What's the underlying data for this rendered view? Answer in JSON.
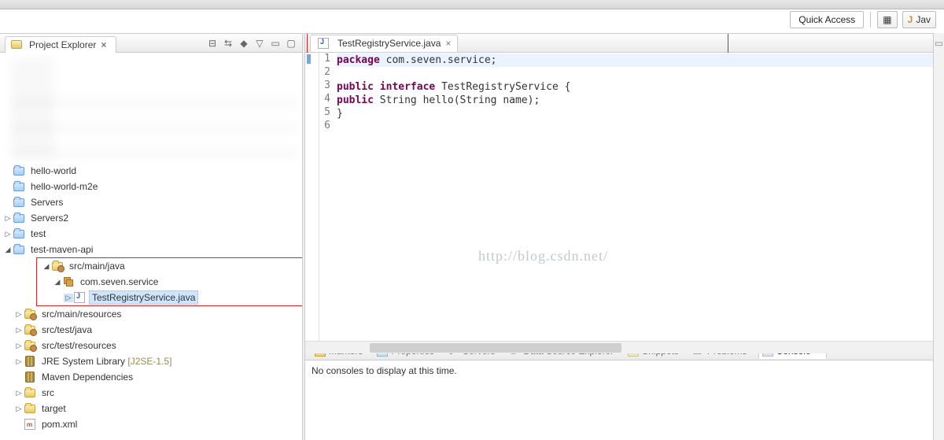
{
  "quick_access": {
    "label": "Quick Access",
    "java_perspective": "Jav"
  },
  "project_explorer": {
    "title": "Project Explorer",
    "nodes": {
      "hello_world": "hello-world",
      "hello_world_m2e": "hello-world-m2e",
      "servers": "Servers",
      "servers2": "Servers2",
      "test": "test",
      "test_maven_api": "test-maven-api",
      "src_main_java": "src/main/java",
      "com_seven_service": "com.seven.service",
      "test_registry_service": "TestRegistryService.java",
      "src_main_resources": "src/main/resources",
      "src_test_java": "src/test/java",
      "src_test_resources": "src/test/resources",
      "jre_system_library": "JRE System Library",
      "jre_version": "[J2SE-1.5]",
      "maven_dependencies": "Maven Dependencies",
      "src": "src",
      "target": "target",
      "pom_xml": "pom.xml"
    }
  },
  "editor": {
    "tab_label": "TestRegistryService.java",
    "lines": [
      "1",
      "2",
      "3",
      "4",
      "5",
      "6"
    ],
    "code": {
      "l1_kw1": "package",
      "l1_rest": " com.seven.service;",
      "l3_kw1": "public",
      "l3_kw2": "interface",
      "l3_rest": " TestRegistryService {",
      "l4_kw1": "public",
      "l4_rest": " String hello(String name);",
      "l5": "}"
    }
  },
  "watermark": "http://blog.csdn.net/",
  "bottom": {
    "tabs": {
      "markers": "Markers",
      "properties": "Properties",
      "servers": "Servers",
      "data_source_explorer": "Data Source Explorer",
      "snippets": "Snippets",
      "problems": "Problems",
      "console": "Console"
    },
    "console_msg": "No consoles to display at this time."
  }
}
